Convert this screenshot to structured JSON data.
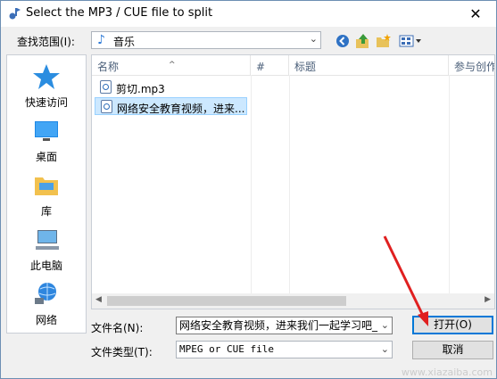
{
  "dialog": {
    "title": "Select the MP3 / CUE file to split"
  },
  "lookin": {
    "label": "查找范围(I):",
    "value": "音乐"
  },
  "toolbar": {
    "icons": [
      "back-icon",
      "up-folder-icon",
      "new-folder-icon",
      "view-menu-icon"
    ]
  },
  "places": [
    {
      "label": "快速访问",
      "icon": "star-icon"
    },
    {
      "label": "桌面",
      "icon": "desktop-icon"
    },
    {
      "label": "库",
      "icon": "library-icon"
    },
    {
      "label": "此电脑",
      "icon": "computer-icon"
    },
    {
      "label": "网络",
      "icon": "network-icon"
    }
  ],
  "filelist": {
    "columns": [
      "名称",
      "#",
      "标题",
      "参与创作"
    ],
    "files": [
      {
        "name": "剪切.mp3",
        "selected": false
      },
      {
        "name": "网络安全教育视频，进来...",
        "selected": true
      }
    ]
  },
  "filename": {
    "label": "文件名(N):",
    "value": "网络安全教育视频，进来我们一起学习吧_"
  },
  "filetype": {
    "label": "文件类型(T):",
    "value": "MPEG or CUE file"
  },
  "buttons": {
    "open": "打开(O)",
    "cancel": "取消"
  },
  "watermark": "www.xiazaiba.com",
  "colors": {
    "selection": "#cce8ff",
    "accent": "#0078d7",
    "arrow": "#e02020"
  }
}
